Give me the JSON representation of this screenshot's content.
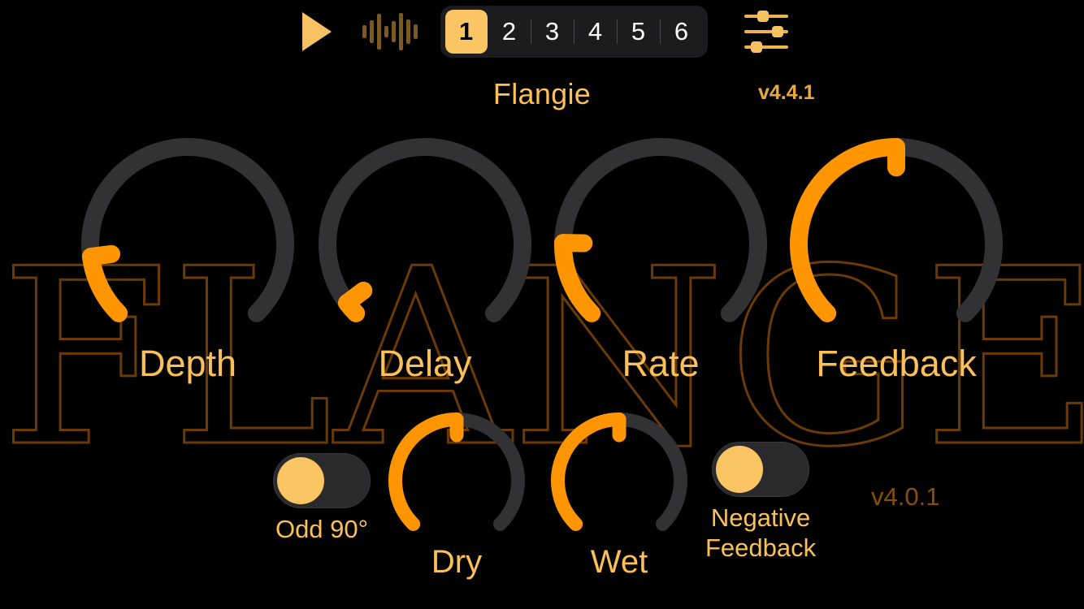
{
  "app": {
    "title": "Flangie",
    "version_top": "v4.4.1",
    "version_bottom": "v4.0.1",
    "background_watermark": "FLANGE"
  },
  "colors": {
    "background": "#000000",
    "accent_amber": "#fbc563",
    "accent_orange": "#ff9500",
    "track_grey": "#323234",
    "label_amber": "#fbc059",
    "watermark_brown": "#6b3a06",
    "version_bottom_brown": "#8a4e09",
    "preset_bar_bg": "#1c1c1e",
    "waveform_dim": "#7a5a22"
  },
  "toolbar": {
    "play_button": {
      "name": "play",
      "icon": "play-triangle-icon",
      "state": "stopped"
    },
    "waveform_button": {
      "name": "waveform",
      "icon": "waveform-icon",
      "state": "inactive"
    },
    "settings_button": {
      "name": "settings",
      "icon": "sliders-icon"
    },
    "presets": {
      "selected": "1",
      "items": [
        "1",
        "2",
        "3",
        "4",
        "5",
        "6"
      ]
    }
  },
  "knobs": [
    {
      "id": "depth",
      "label": "Depth",
      "value_pct": 14,
      "arc_start_deg": 135,
      "arc_sweep_deg": 270
    },
    {
      "id": "delay",
      "label": "Delay",
      "value_pct": 3,
      "arc_start_deg": 135,
      "arc_sweep_deg": 270
    },
    {
      "id": "rate",
      "label": "Rate",
      "value_pct": 17,
      "arc_start_deg": 135,
      "arc_sweep_deg": 270
    },
    {
      "id": "feedback",
      "label": "Feedback",
      "value_pct": 50,
      "arc_start_deg": 135,
      "arc_sweep_deg": 270
    },
    {
      "id": "dry",
      "label": "Dry",
      "value_pct": 50,
      "arc_start_deg": 135,
      "arc_sweep_deg": 270
    },
    {
      "id": "wet",
      "label": "Wet",
      "value_pct": 50,
      "arc_start_deg": 135,
      "arc_sweep_deg": 270
    }
  ],
  "toggles": [
    {
      "id": "odd90",
      "label": "Odd 90°",
      "on": false
    },
    {
      "id": "negative_feedback",
      "label": "Negative\nFeedback",
      "on": false
    }
  ]
}
